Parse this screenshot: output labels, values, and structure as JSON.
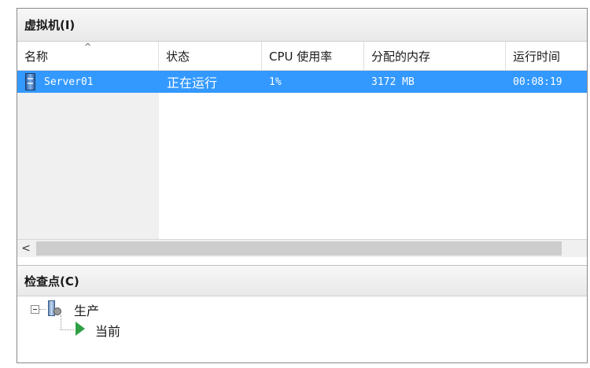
{
  "vm_section": {
    "title": "虚拟机(I)",
    "columns": [
      "名称",
      "状态",
      "CPU 使用率",
      "分配的内存",
      "运行时间"
    ],
    "sort_indicator": "^",
    "rows": [
      {
        "name": "Server01",
        "status": "正在运行",
        "cpu": "1%",
        "memory": "3172 MB",
        "uptime": "00:08:19"
      }
    ],
    "scroll_left_arrow": "<"
  },
  "checkpoint_section": {
    "title": "检查点(C)",
    "tree": [
      {
        "label": "生产",
        "icon": "checkpoint-server-icon",
        "expanded": true
      },
      {
        "label": "当前",
        "icon": "play-icon"
      }
    ]
  },
  "colors": {
    "selection": "#3399ff",
    "header_bg": "#eeeeee",
    "current_marker": "#2ea043"
  }
}
